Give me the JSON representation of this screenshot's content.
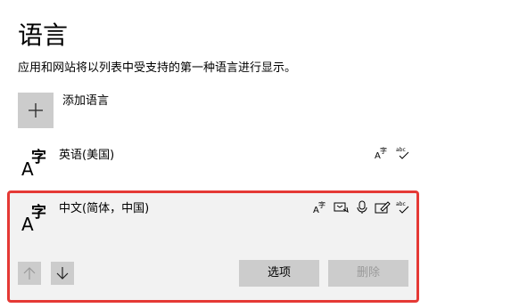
{
  "page": {
    "title": "语言",
    "description": "应用和网站将以列表中受支持的第一种语言进行显示。"
  },
  "add_language": {
    "label": "添加语言",
    "icon": "plus-icon"
  },
  "languages": [
    {
      "name": "英语(美国)",
      "glyph_a": "A",
      "glyph_z": "字",
      "features": [
        "display-language-icon",
        "spell-check-icon"
      ]
    },
    {
      "name": "中文(简体，中国)",
      "glyph_a": "A",
      "glyph_z": "字",
      "selected": true,
      "features": [
        "display-language-icon",
        "text-to-speech-icon",
        "speech-recognition-icon",
        "handwriting-icon",
        "spell-check-icon"
      ],
      "actions": {
        "options_label": "选项",
        "remove_label": "删除",
        "remove_disabled": true
      }
    }
  ],
  "colors": {
    "selection_border": "#e53935",
    "button_bg": "#cccccc",
    "card_bg": "#f2f2f2"
  }
}
